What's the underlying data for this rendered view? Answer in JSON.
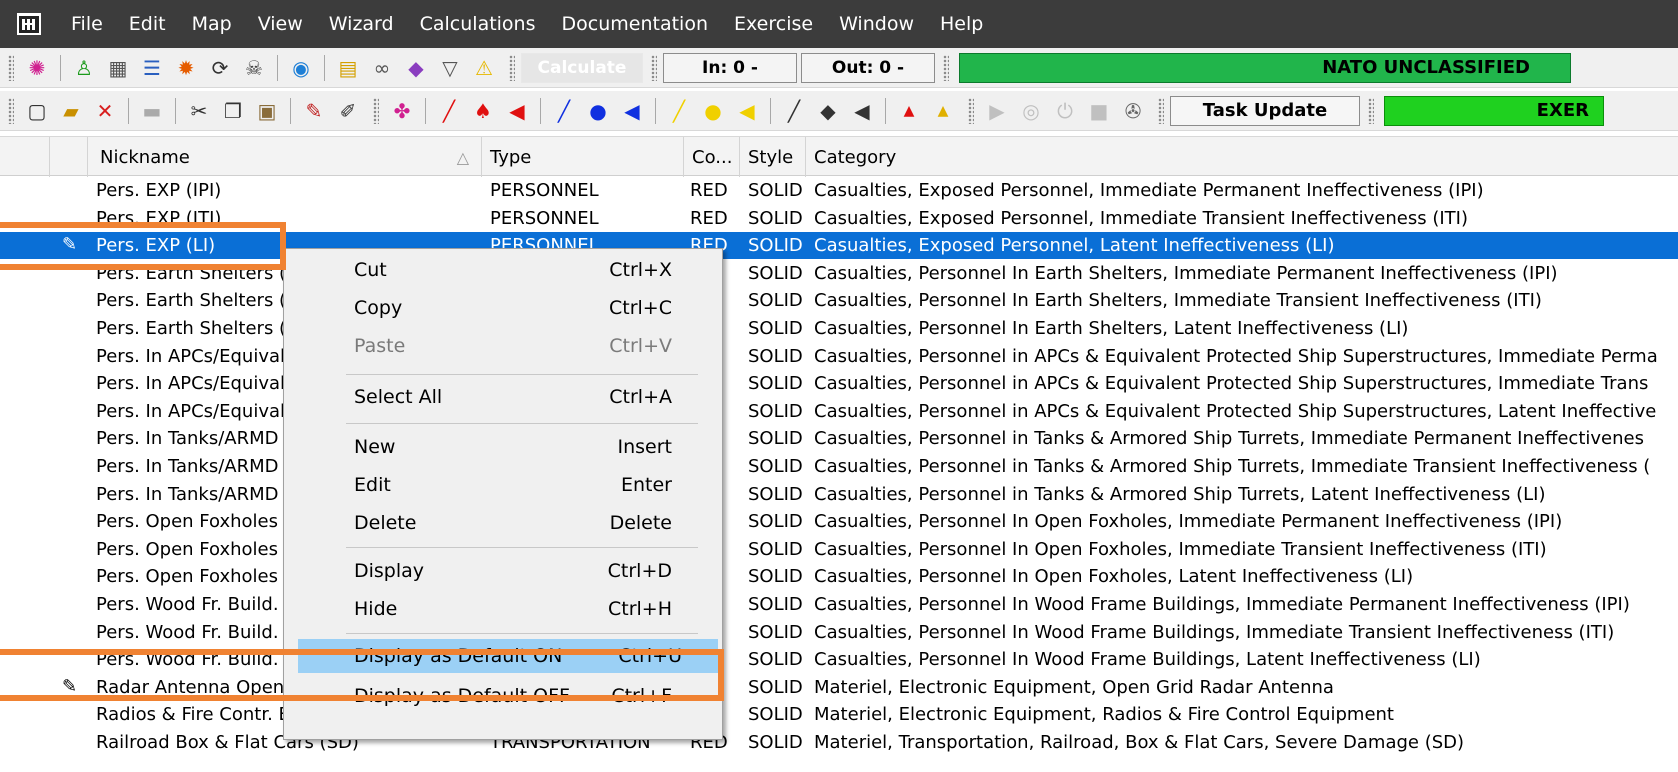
{
  "menubar": {
    "items": [
      "File",
      "Edit",
      "Map",
      "View",
      "Wizard",
      "Calculations",
      "Documentation",
      "Exercise",
      "Window",
      "Help"
    ]
  },
  "toolbar1": {
    "calculate_label": "Calculate",
    "in_label": "In: 0 -",
    "out_label": "Out: 0 -",
    "classification": "NATO UNCLASSIFIED"
  },
  "toolbar2": {
    "task_update_label": "Task Update",
    "mode_label": "EXER"
  },
  "grid": {
    "columns": [
      "Nickname",
      "Type",
      "Co...",
      "Style",
      "Category"
    ],
    "rows": [
      {
        "nickname": "Pers. EXP (IPI)",
        "type": "PERSONNEL",
        "color": "RED",
        "style": "SOLID",
        "category": "Casualties, Exposed Personnel, Immediate Permanent Ineffectiveness (IPI)"
      },
      {
        "nickname": "Pers. EXP (ITI)",
        "type": "PERSONNEL",
        "color": "RED",
        "style": "SOLID",
        "category": "Casualties, Exposed Personnel, Immediate Transient Ineffectiveness (ITI)"
      },
      {
        "nickname": "Pers. EXP (LI)",
        "type": "PERSONNEL",
        "color": "RED",
        "style": "SOLID",
        "category": "Casualties, Exposed Personnel, Latent Ineffectiveness (LI)"
      },
      {
        "nickname": "Pers. Earth Shelters (IPI)",
        "type": "",
        "color": "",
        "style": "SOLID",
        "category": "Casualties, Personnel In Earth Shelters, Immediate Permanent Ineffectiveness (IPI)"
      },
      {
        "nickname": "Pers. Earth Shelters (ITI)",
        "type": "",
        "color": "",
        "style": "SOLID",
        "category": "Casualties, Personnel In Earth Shelters, Immediate Transient Ineffectiveness (ITI)"
      },
      {
        "nickname": "Pers. Earth Shelters (LI)",
        "type": "",
        "color": "",
        "style": "SOLID",
        "category": "Casualties, Personnel In Earth Shelters, Latent Ineffectiveness (LI)"
      },
      {
        "nickname": "Pers. In APCs/Equivalent",
        "type": "",
        "color": "",
        "style": "SOLID",
        "category": "Casualties, Personnel in APCs & Equivalent Protected Ship Superstructures, Immediate Perma"
      },
      {
        "nickname": "Pers. In APCs/Equivalent",
        "type": "",
        "color": "",
        "style": "SOLID",
        "category": "Casualties, Personnel in APCs & Equivalent Protected Ship Superstructures, Immediate Trans"
      },
      {
        "nickname": "Pers. In APCs/Equivalent",
        "type": "",
        "color": "",
        "style": "SOLID",
        "category": "Casualties, Personnel in APCs & Equivalent Protected Ship Superstructures, Latent Ineffective"
      },
      {
        "nickname": "Pers. In Tanks/ARMD",
        "type": "",
        "color": "",
        "style": "SOLID",
        "category": "Casualties, Personnel in Tanks & Armored Ship Turrets, Immediate Permanent Ineffectivenes"
      },
      {
        "nickname": "Pers. In Tanks/ARMD",
        "type": "",
        "color": "",
        "style": "SOLID",
        "category": "Casualties, Personnel in Tanks & Armored Ship Turrets, Immediate Transient Ineffectiveness ("
      },
      {
        "nickname": "Pers. In Tanks/ARMD",
        "type": "",
        "color": "",
        "style": "SOLID",
        "category": "Casualties, Personnel in Tanks & Armored Ship Turrets, Latent Ineffectiveness (LI)"
      },
      {
        "nickname": "Pers. Open Foxholes (IPI)",
        "type": "",
        "color": "",
        "style": "SOLID",
        "category": "Casualties, Personnel In Open Foxholes, Immediate Permanent Ineffectiveness (IPI)"
      },
      {
        "nickname": "Pers. Open Foxholes (ITI)",
        "type": "",
        "color": "",
        "style": "SOLID",
        "category": "Casualties, Personnel In Open Foxholes, Immediate Transient Ineffectiveness (ITI)"
      },
      {
        "nickname": "Pers. Open Foxholes (LI)",
        "type": "",
        "color": "",
        "style": "SOLID",
        "category": "Casualties, Personnel In Open Foxholes, Latent Ineffectiveness (LI)"
      },
      {
        "nickname": "Pers. Wood Fr. Build. (IPI)",
        "type": "",
        "color": "",
        "style": "SOLID",
        "category": "Casualties, Personnel In Wood Frame Buildings, Immediate Permanent Ineffectiveness (IPI)"
      },
      {
        "nickname": "Pers. Wood Fr. Build. (ITI)",
        "type": "",
        "color": "",
        "style": "SOLID",
        "category": "Casualties, Personnel In Wood Frame Buildings, Immediate Transient Ineffectiveness (ITI)"
      },
      {
        "nickname": "Pers. Wood Fr. Build. (LI)",
        "type": "",
        "color": "",
        "style": "SOLID",
        "category": "Casualties, Personnel In Wood Frame Buildings, Latent Ineffectiveness (LI)"
      },
      {
        "nickname": "Radar Antenna Open Grid",
        "type": "",
        "color": "",
        "style": "SOLID",
        "category": "Materiel, Electronic Equipment, Open Grid Radar Antenna"
      },
      {
        "nickname": "Radios & Fire Contr. Equip.",
        "type": "",
        "color": "",
        "style": "SOLID",
        "category": "Materiel, Electronic Equipment, Radios & Fire Control Equipment"
      },
      {
        "nickname": "Railroad Box & Flat Cars (SD)",
        "type": "TRANSPORTATION",
        "color": "RED",
        "style": "SOLID",
        "category": "Materiel, Transportation, Railroad, Box & Flat Cars, Severe Damage (SD)"
      }
    ]
  },
  "context_menu": {
    "cut": {
      "label": "Cut",
      "shortcut": "Ctrl+X"
    },
    "copy": {
      "label": "Copy",
      "shortcut": "Ctrl+C"
    },
    "paste": {
      "label": "Paste",
      "shortcut": "Ctrl+V"
    },
    "select_all": {
      "label": "Select All",
      "shortcut": "Ctrl+A"
    },
    "new": {
      "label": "New",
      "shortcut": "Insert"
    },
    "edit": {
      "label": "Edit",
      "shortcut": "Enter"
    },
    "delete": {
      "label": "Delete",
      "shortcut": "Delete"
    },
    "display": {
      "label": "Display",
      "shortcut": "Ctrl+D"
    },
    "hide": {
      "label": "Hide",
      "shortcut": "Ctrl+H"
    },
    "default_on": {
      "label": "Display as Default ON",
      "shortcut": "Ctrl+U"
    },
    "default_off": {
      "label": "Display as Default OFF",
      "shortcut": "Ctrl+F"
    }
  },
  "colors": {
    "menubar_bg": "#3c3c3c",
    "selection": "#0a6fd6",
    "menu_highlight": "#9bd0f5",
    "annotation": "#f08232",
    "nato_green": "#21b54b",
    "exer_green": "#1fd11f"
  }
}
